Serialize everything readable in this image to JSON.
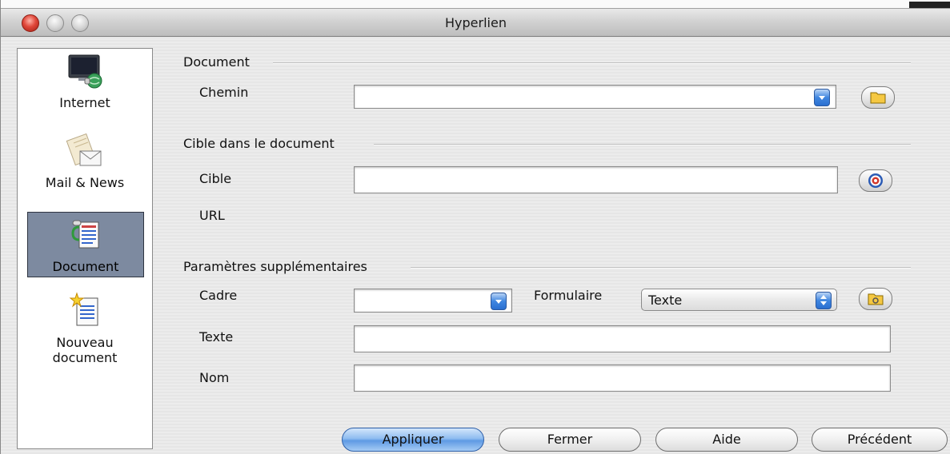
{
  "window": {
    "title": "Hyperlien"
  },
  "sidebar": {
    "items": [
      {
        "label": "Internet",
        "icon": "internet-globe-icon",
        "selected": false
      },
      {
        "label": "Mail & News",
        "icon": "mail-envelope-icon",
        "selected": false
      },
      {
        "label": "Document",
        "icon": "document-link-icon",
        "selected": true
      },
      {
        "label_line1": "Nouveau",
        "label_line2": "document",
        "icon": "new-document-icon",
        "selected": false
      }
    ]
  },
  "sections": {
    "document": {
      "heading": "Document",
      "chemin_label": "Chemin",
      "chemin_value": "",
      "open_file_icon": "folder-icon"
    },
    "target": {
      "heading": "Cible dans le document",
      "cible_label": "Cible",
      "cible_value": "",
      "url_label": "URL",
      "target_icon": "target-icon"
    },
    "extra": {
      "heading": "Paramètres supplémentaires",
      "cadre_label": "Cadre",
      "cadre_value": "",
      "formulaire_label": "Formulaire",
      "formulaire_value": "Texte",
      "events_icon": "events-icon",
      "texte_label": "Texte",
      "texte_value": "",
      "nom_label": "Nom",
      "nom_value": ""
    }
  },
  "buttons": {
    "apply": "Appliquer",
    "close": "Fermer",
    "help": "Aide",
    "back": "Précédent"
  },
  "colors": {
    "selected_item_bg": "#7d8aa0",
    "default_button": "#5e9ae4",
    "close_light": "#e0473a"
  }
}
